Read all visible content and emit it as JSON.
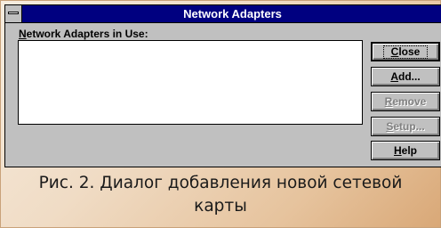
{
  "window": {
    "title": "Network Adapters"
  },
  "list": {
    "label_mnemonic": "N",
    "label_rest": "etwork Adapters in Use:",
    "items": []
  },
  "buttons": {
    "close": {
      "label": "Close",
      "mnemonic": "C",
      "rest": "lose"
    },
    "add": {
      "label": "Add...",
      "mnemonic": "A",
      "rest": "dd..."
    },
    "remove": {
      "label": "Remove",
      "mnemonic": "R",
      "rest": "emove"
    },
    "setup": {
      "label": "Setup...",
      "mnemonic": "S",
      "rest": "etup..."
    },
    "help": {
      "label": "Help",
      "mnemonic": "H",
      "rest": "elp"
    }
  },
  "caption": {
    "line1": "Рис. 2. Диалог добавления новой сетевой",
    "line2": "карты"
  },
  "colors": {
    "titlebar": "#000080",
    "face": "#c0c0c0",
    "caption_gradient_end": "#d9a877"
  }
}
